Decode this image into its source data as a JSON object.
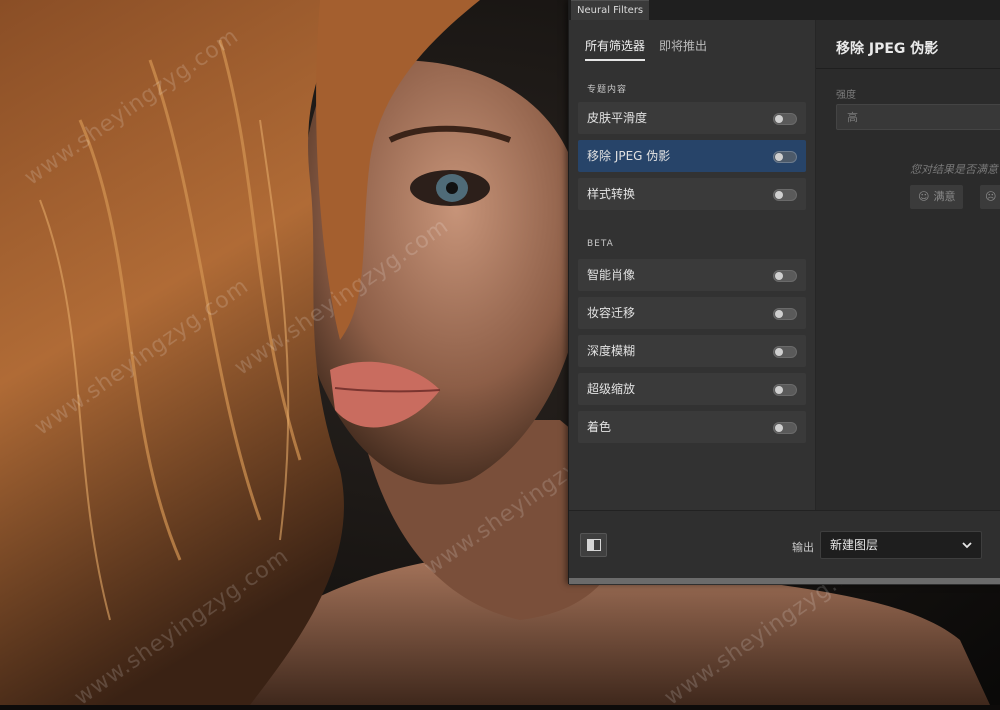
{
  "window": {
    "title": "Neural Filters"
  },
  "tabs": [
    {
      "label": "所有筛选器",
      "active": true
    },
    {
      "label": "即将推出",
      "active": false
    }
  ],
  "sections": {
    "featured": "专题内容",
    "beta": "BETA"
  },
  "featured_items": [
    {
      "label": "皮肤平滑度",
      "enabled": false,
      "selected": false
    },
    {
      "label": "移除 JPEG 伪影",
      "enabled": false,
      "selected": true
    },
    {
      "label": "样式转换",
      "enabled": false,
      "selected": false
    }
  ],
  "beta_items": [
    {
      "label": "智能肖像",
      "enabled": false
    },
    {
      "label": "妆容迁移",
      "enabled": false
    },
    {
      "label": "深度模糊",
      "enabled": false
    },
    {
      "label": "超级缩放",
      "enabled": false
    },
    {
      "label": "着色",
      "enabled": false
    }
  ],
  "detail": {
    "title": "移除 JPEG 伪影",
    "strength_label": "强度",
    "strength_value": "高",
    "feedback_question": "您对结果是否满意",
    "satisfied_label": "满意"
  },
  "footer": {
    "output_label": "输出",
    "output_value": "新建图层"
  },
  "watermark": "www.sheyingzyg.com",
  "colors": {
    "panel_bg": "#323232",
    "selected_item": "#274469",
    "item_bg": "#3a3a3a"
  }
}
